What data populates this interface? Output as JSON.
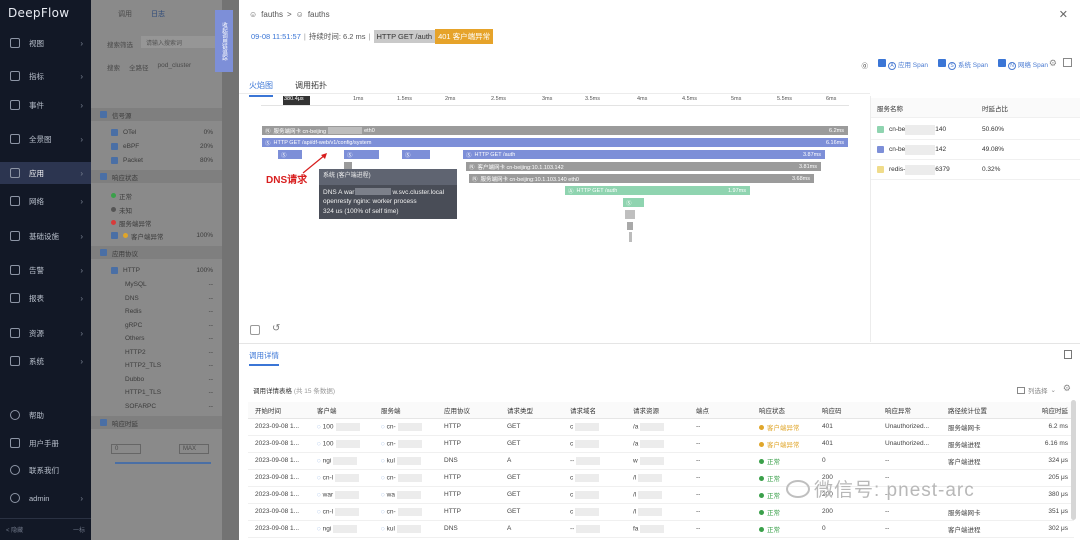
{
  "nav": {
    "logo": "DeepFlow",
    "items": [
      {
        "label": "视图"
      },
      {
        "label": "指标"
      },
      {
        "label": "事件"
      },
      {
        "label": "全景图"
      },
      {
        "label": "应用"
      },
      {
        "label": "网络"
      },
      {
        "label": "基础设施"
      },
      {
        "label": "告警"
      },
      {
        "label": "报表"
      },
      {
        "label": "资源"
      },
      {
        "label": "系统"
      }
    ],
    "bottom": [
      {
        "label": "帮助"
      },
      {
        "label": "用户手册"
      },
      {
        "label": "联系我们"
      },
      {
        "label": "admin"
      }
    ],
    "footer_left": "< 隐藏",
    "footer_right": "一标"
  },
  "panel2": {
    "tab1": "调用",
    "tab2": "日志",
    "search_label": "搜索筛选",
    "search_placeholder": "请输入搜索词",
    "filter1": "搜索",
    "filter2": "全路径",
    "filter3": "pod_cluster",
    "section1": "信号源",
    "signals": [
      {
        "label": "OTel",
        "value": "0%"
      },
      {
        "label": "eBPF",
        "value": "20%"
      },
      {
        "label": "Packet",
        "value": "80%"
      }
    ],
    "section2": "响应状态",
    "statuses": [
      {
        "label": "正常",
        "color": "#3aa04a"
      },
      {
        "label": "未知",
        "color": "#555555"
      },
      {
        "label": "服务端异常",
        "color": "#d83b3b"
      },
      {
        "label": "客户端异常",
        "color": "#e0a62a",
        "value": "100%"
      }
    ],
    "section3": "应用协议",
    "protocols": [
      {
        "label": "HTTP",
        "value": "100%"
      },
      {
        "label": "MySQL",
        "value": "--"
      },
      {
        "label": "DNS",
        "value": "--"
      },
      {
        "label": "Redis",
        "value": "--"
      },
      {
        "label": "gRPC",
        "value": "--"
      },
      {
        "label": "Others",
        "value": "--"
      },
      {
        "label": "HTTP2",
        "value": "--"
      },
      {
        "label": "HTTP2_TLS",
        "value": "--"
      },
      {
        "label": "Dubbo",
        "value": "--"
      },
      {
        "label": "HTTP1_TLS",
        "value": "--"
      },
      {
        "label": "SOFARPC",
        "value": "--"
      }
    ],
    "section4": "响应时延",
    "slider_left": "0",
    "slider_right": "MAX"
  },
  "strip": {
    "label": "收起调用链追踪"
  },
  "drawer": {
    "crumb1": "fauths",
    "crumb_sep": ">",
    "crumb2": "fauths",
    "time": "09-08 11:51:57",
    "duration": "持续时间: 6.2 ms",
    "request": "HTTP GET /auth",
    "error": "401 客户端异常",
    "legend": {
      "app": "应用 Span",
      "sys": "系统 Span",
      "net": "网络 Span"
    },
    "tabs": [
      "火焰图",
      "调用拓扑"
    ],
    "ruler_start": "380.4μs",
    "ticks": [
      "1ms",
      "1.5ms",
      "2ms",
      "2.5ms",
      "3ms",
      "3.5ms",
      "4ms",
      "4.5ms",
      "5ms",
      "5.5ms",
      "6ms"
    ],
    "bars": [
      {
        "label": "服务端网卡 cn-beijing",
        "suffix": "eth0",
        "dur": "6.2ms",
        "color": "#9b9b9b"
      },
      {
        "label": "HTTP GET /api/df-web/v1/config/system",
        "dur": "6.16ms",
        "color": "#7d8fd8"
      },
      {
        "label": "HTTP GET /auth",
        "dur": "3.87ms",
        "color": "#7d8fd8"
      },
      {
        "label": "客户端网卡 cn-beijing:10.1.103.142",
        "dur": "3.81ms",
        "color": "#9b9b9b"
      },
      {
        "label": "服务端网卡 cn-beijing:10.1.103.140 eth0",
        "dur": "3.68ms",
        "color": "#9b9b9b"
      },
      {
        "label": "HTTP GET /auth",
        "dur": "1.97ms",
        "color": "#8fd4b0"
      }
    ],
    "annotation": "DNS请求",
    "tooltip": {
      "title": "系统 (客户端进程)",
      "line1": "DNS A war",
      "line1b": "w.svc.cluster.local",
      "line2": "openresty nginx: worker process",
      "line3": "324 us (100% of self time)"
    },
    "svc_header": {
      "name": "服务名称",
      "pct": "时延占比"
    },
    "svc_rows": [
      {
        "name": "cn-be",
        "id": "140",
        "pct": "50.60%",
        "color": "#8fd4b0"
      },
      {
        "name": "cn-be",
        "id": "142",
        "pct": "49.08%",
        "color": "#7d8fd8"
      },
      {
        "name": "redis-",
        "id": "6379",
        "pct": "0.32%",
        "color": "#f0dc8a"
      }
    ],
    "detail_tab": "调用详情",
    "table_title": "调用详情表格",
    "table_count": "(共 15 条数据)",
    "col_select": "列选择",
    "columns": [
      "开始时间",
      "客户端",
      "服务端",
      "应用协议",
      "请求类型",
      "请求域名",
      "请求资源",
      "端点",
      "响应状态",
      "响应码",
      "响应异常",
      "路径统计位置",
      "响应时延"
    ],
    "rows": [
      {
        "start": "2023-09-08 1...",
        "client": "100",
        "server": "cn-",
        "proto": "HTTP",
        "type": "GET",
        "domain": "c",
        "res": "/a",
        "end": "--",
        "status": "客户端异常",
        "scolor": "#e0a62a",
        "code": "401",
        "err": "Unauthorized...",
        "loc": "服务端网卡",
        "lat": "6.2 ms"
      },
      {
        "start": "2023-09-08 1...",
        "client": "100",
        "server": "cn-",
        "proto": "HTTP",
        "type": "GET",
        "domain": "c",
        "res": "/a",
        "end": "--",
        "status": "客户端异常",
        "scolor": "#e0a62a",
        "code": "401",
        "err": "Unauthorized...",
        "loc": "服务端进程",
        "lat": "6.16 ms"
      },
      {
        "start": "2023-09-08 1...",
        "client": "ngi",
        "server": "kul",
        "proto": "DNS",
        "type": "A",
        "domain": "--",
        "res": "w",
        "end": "--",
        "status": "正常",
        "scolor": "#3aa04a",
        "code": "0",
        "err": "--",
        "loc": "客户端进程",
        "lat": "324 μs"
      },
      {
        "start": "2023-09-08 1...",
        "client": "cn-l",
        "server": "cn-",
        "proto": "HTTP",
        "type": "GET",
        "domain": "c",
        "res": "/l",
        "end": "--",
        "status": "正常",
        "scolor": "#3aa04a",
        "code": "200",
        "err": "--",
        "loc": "",
        "lat": "205 μs"
      },
      {
        "start": "2023-09-08 1...",
        "client": "war",
        "server": "wa",
        "proto": "HTTP",
        "type": "GET",
        "domain": "c",
        "res": "/l",
        "end": "--",
        "status": "正常",
        "scolor": "#3aa04a",
        "code": "200",
        "err": "--",
        "loc": "",
        "lat": "380 μs"
      },
      {
        "start": "2023-09-08 1...",
        "client": "cn-l",
        "server": "cn-",
        "proto": "HTTP",
        "type": "GET",
        "domain": "c",
        "res": "/l",
        "end": "--",
        "status": "正常",
        "scolor": "#3aa04a",
        "code": "200",
        "err": "--",
        "loc": "服务端网卡",
        "lat": "351 μs"
      },
      {
        "start": "2023-09-08 1...",
        "client": "ngi",
        "server": "kul",
        "proto": "DNS",
        "type": "A",
        "domain": "--",
        "res": "fa",
        "end": "--",
        "status": "正常",
        "scolor": "#3aa04a",
        "code": "0",
        "err": "--",
        "loc": "客户端进程",
        "lat": "302 μs"
      }
    ],
    "watermark": "微信号: pnest-arc"
  }
}
